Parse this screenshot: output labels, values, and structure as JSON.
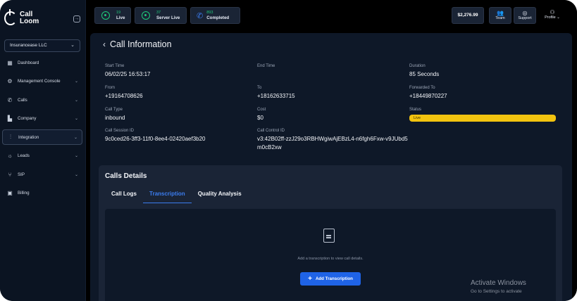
{
  "app": {
    "logo_text": "Call Loom"
  },
  "sidebar": {
    "company": "Insurancease LLC",
    "items": [
      {
        "label": "Dashboard",
        "icon": "dashboard-icon",
        "has_chevron": false
      },
      {
        "label": "Management Console",
        "icon": "gear-icon",
        "has_chevron": true
      },
      {
        "label": "Calls",
        "icon": "phone-icon",
        "has_chevron": true
      },
      {
        "label": "Company",
        "icon": "building-icon",
        "has_chevron": true
      },
      {
        "label": "Integration",
        "icon": "sliders-icon",
        "has_chevron": true,
        "active": true
      },
      {
        "label": "Leads",
        "icon": "lightbulb-icon",
        "has_chevron": true
      },
      {
        "label": "SIP",
        "icon": "network-icon",
        "has_chevron": true
      },
      {
        "label": "Billing",
        "icon": "billing-icon",
        "has_chevron": false
      }
    ]
  },
  "topbar": {
    "stats": [
      {
        "value": "19",
        "label": "Live"
      },
      {
        "value": "37",
        "label": "Server Live"
      },
      {
        "value": "893",
        "label": "Completed"
      }
    ],
    "balance": "$2,276.99",
    "team_label": "Team",
    "support_label": "Support",
    "profile_label": "Profile"
  },
  "call": {
    "title": "Call Information",
    "start_time_label": "Start Time",
    "start_time": "06/02/25 16:53:17",
    "end_time_label": "End Time",
    "end_time": "",
    "duration_label": "Duration",
    "duration": "85 Seconds",
    "from_label": "From",
    "from": "+19164708626",
    "to_label": "To",
    "to": "+18162633715",
    "forwarded_label": "Forwarded To",
    "forwarded": "+18449870227",
    "type_label": "Call Type",
    "type": "inbound",
    "cost_label": "Cost",
    "cost": "$0",
    "status_label": "Status",
    "status": "Live",
    "session_label": "Call Session ID",
    "session_id": "9c0ced26-3ff3-11f0-8ee4-02420aef3b20",
    "control_label": "Call Control ID",
    "control_id": "v3:42B02ff-zzJ29o3RBHWgiwAjEBzL4-n6fgh6Fxw-v9JUbd5m0cB2xw"
  },
  "details": {
    "title": "Calls Details",
    "tabs": [
      "Call Logs",
      "Transcription",
      "Quality Analysis"
    ],
    "active_tab": "Transcription",
    "empty_text": "Add a transcription to view call details.",
    "add_button": "Add Transcription"
  },
  "watermark": {
    "title": "Activate Windows",
    "subtitle": "Go to Settings to activate"
  },
  "colors": {
    "accent": "#1f63e6",
    "live_green": "#1ec97a",
    "status_yellow": "#f2c30f"
  }
}
